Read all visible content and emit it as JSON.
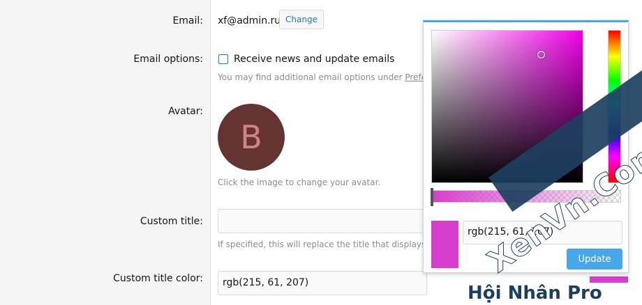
{
  "form": {
    "email_label": "Email:",
    "email_value": "xf@admin.ru",
    "change_button": "Change",
    "email_options_label": "Email options:",
    "receive_news_label": "Receive news and update emails",
    "email_hint_prefix": "You may find additional email options under ",
    "email_hint_link": "Prefe",
    "avatar_label": "Avatar:",
    "avatar_letter": "B",
    "avatar_hint": "Click the image to change your avatar.",
    "custom_title_label": "Custom title:",
    "custom_title_value": "",
    "custom_title_hint": "If specified, this will replace the title that displays u",
    "custom_title_color_label": "Custom title color:",
    "custom_title_color_value": "rgb(215, 61, 207)"
  },
  "picker": {
    "value": "rgb(215, 61, 207)",
    "update_button": "Update",
    "current_color": "#d73dcf"
  },
  "watermark": {
    "main": "XenVn.Com",
    "bottom": "Hội Nhân Pro"
  },
  "colors": {
    "accent": "#47a7eb",
    "link": "#2577b1",
    "avatar_bg": "#663333"
  }
}
